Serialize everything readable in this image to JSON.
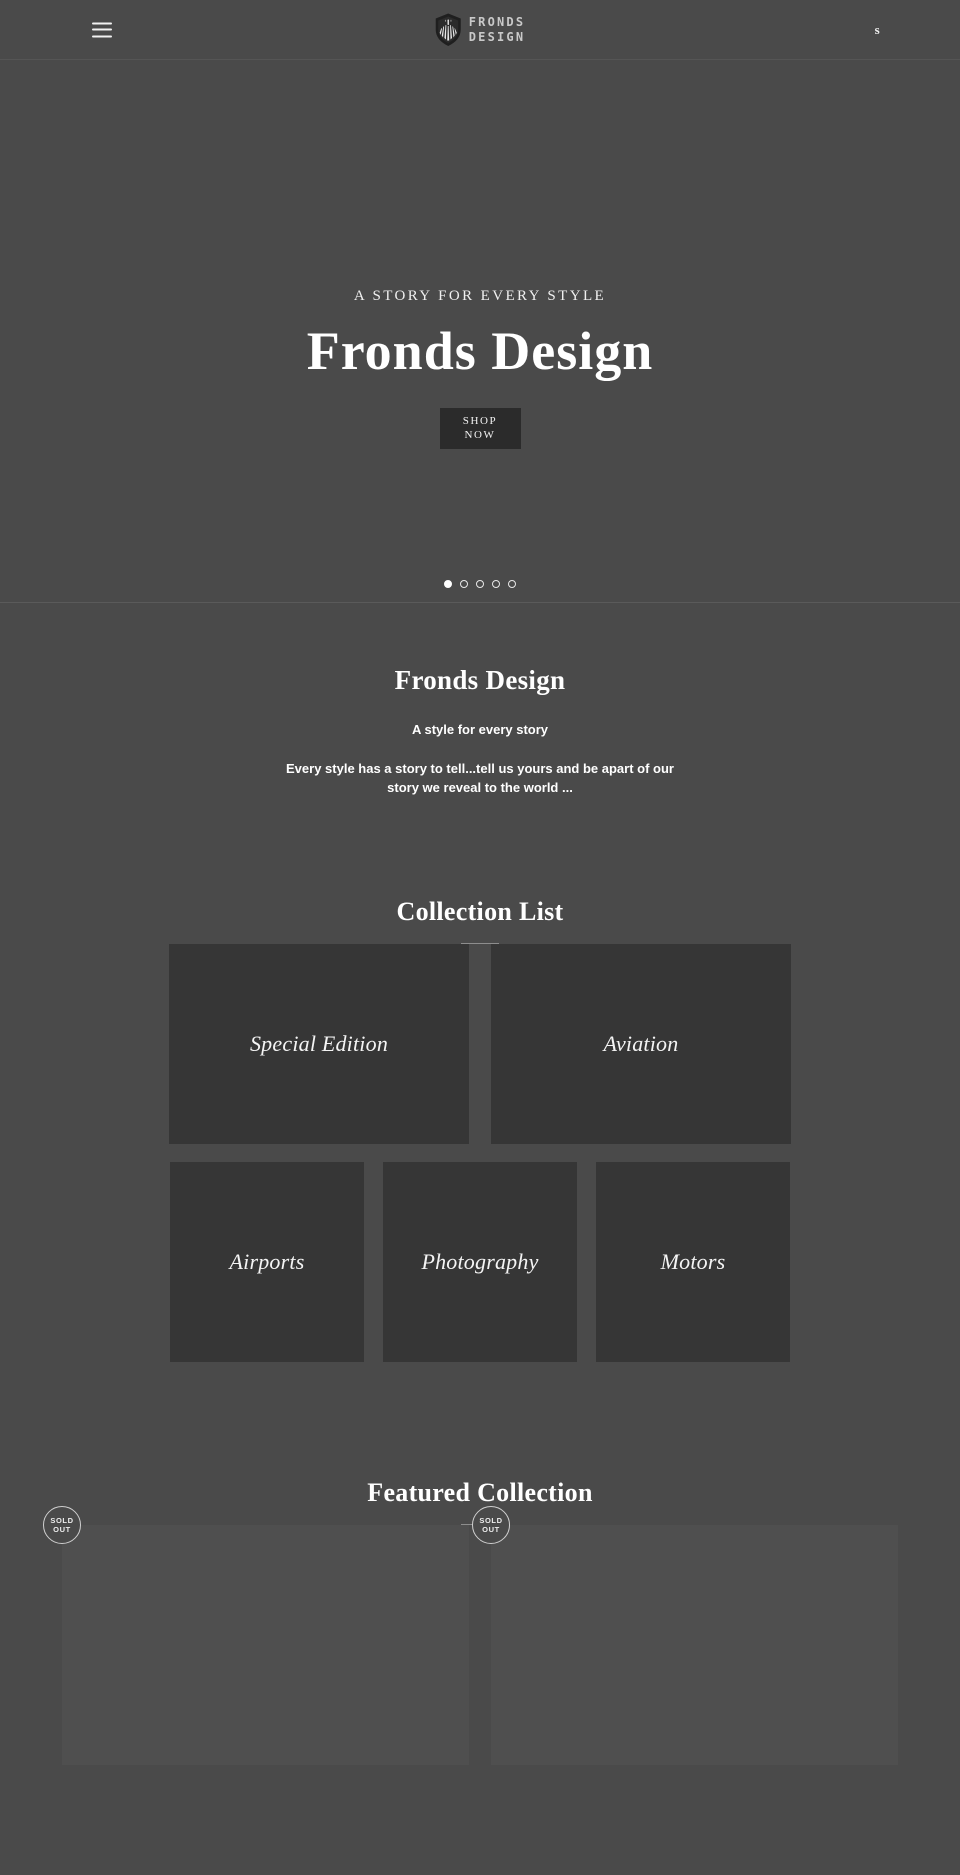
{
  "theme": {
    "background": "#4a4a4a",
    "card_background": "#363636",
    "product_background": "#4f4f4f",
    "button_background": "#2b2b2b",
    "text": "#ffffff",
    "rule": "#8d8d8d"
  },
  "header": {
    "menu_icon": "hamburger-icon",
    "logo_icon": "fronds-shield-icon",
    "brand_line1": "FRONDS",
    "brand_line2": "DESIGN",
    "search_label": "s"
  },
  "hero": {
    "eyebrow": "A STORY FOR EVERY STYLE",
    "title": "Fronds Design",
    "cta_line1": "SHOP",
    "cta_line2": "NOW",
    "slides": [
      {
        "index": 1,
        "active": true
      },
      {
        "index": 2,
        "active": false
      },
      {
        "index": 3,
        "active": false
      },
      {
        "index": 4,
        "active": false
      },
      {
        "index": 5,
        "active": false
      }
    ]
  },
  "intro": {
    "title": "Fronds Design",
    "tagline": "A style for every story",
    "body": "Every style has a story to tell...tell us yours and be apart of our story we reveal to the world ..."
  },
  "collection_list": {
    "heading": "Collection List",
    "row_top": [
      {
        "label": "Special Edition"
      },
      {
        "label": "Aviation"
      }
    ],
    "row_bottom": [
      {
        "label": "Airports"
      },
      {
        "label": "Photography"
      },
      {
        "label": "Motors"
      }
    ]
  },
  "featured": {
    "heading": "Featured Collection",
    "products": [
      {
        "badge_line1": "SOLD",
        "badge_line2": "OUT"
      },
      {
        "badge_line1": "SOLD",
        "badge_line2": "OUT"
      }
    ]
  }
}
